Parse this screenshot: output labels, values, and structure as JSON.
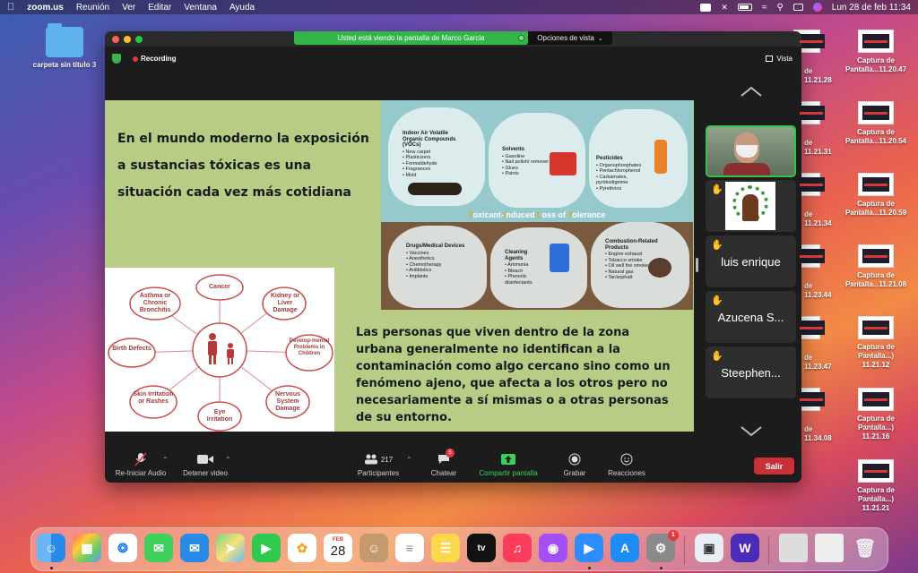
{
  "menubar": {
    "app_name": "zoom.us",
    "menus": [
      "Reunión",
      "Ver",
      "Editar",
      "Ventana",
      "Ayuda"
    ],
    "datetime": "Lun 28 de feb  11:34"
  },
  "desktop": {
    "folder_label": "carpeta sin título 3",
    "screenshots": [
      {
        "line1": "Captura de",
        "line2": "Pantalla...11.20.47"
      },
      {
        "line1": "Captura de",
        "line2": "Pantalla...11.20.54"
      },
      {
        "line1": "Captura de",
        "line2": "Pantalla...11.20.59"
      },
      {
        "line1": "Captura de",
        "line2": "Pantalla...11.21.08"
      },
      {
        "line1": "Captura de",
        "line2": "Pantalla...) 11.21.12"
      },
      {
        "line1": "Captura de",
        "line2": "Pantalla...) 11.21.16"
      },
      {
        "line1": "Captura de",
        "line2": "Pantalla...) 11.21.21"
      }
    ],
    "partial_labels": [
      {
        "line1": "de",
        "line2": "11.21.28"
      },
      {
        "line1": "de",
        "line2": "11.21.31"
      },
      {
        "line1": "de",
        "line2": "11.21.34"
      },
      {
        "line1": "de",
        "line2": "11.23.44"
      },
      {
        "line1": "de",
        "line2": "11.23.47"
      },
      {
        "line1": "de",
        "line2": "11.34.08"
      }
    ]
  },
  "zoom": {
    "share_banner": "Usted está viendo la pantalla de Marco Garcia",
    "view_options": "Opciones de vista",
    "recording": "Recording",
    "view_label": "Vista",
    "slide": {
      "top_text": "En el mundo moderno la exposición a sustancias tóxicas es una situación cada vez más cotidiana",
      "bottom_text": "Las personas que viven dentro de la zona urbana generalmente no identifican a la contaminación como algo cercano sino como un fenómeno ajeno, que afecta a los otros pero no necesariamente a sí mismas o a otras personas de su entorno.",
      "infographic": {
        "title_parts": [
          "T",
          "oxicant-",
          "I",
          "nduced ",
          "L",
          "oss of ",
          "T",
          "olerance"
        ],
        "bags": [
          {
            "title": "Indoor Air Volatile Organic Compounds (VOCs)",
            "items": [
              "• New carpet",
              "• Plasticizers",
              "• Formaldehyde",
              "• Fragrances",
              "• Mold"
            ]
          },
          {
            "title": "Solvents",
            "items": [
              "• Gasoline",
              "• Nail polish/ remover",
              "• Glues",
              "• Paints"
            ]
          },
          {
            "title": "Pesticides",
            "items": [
              "• Organophosphates",
              "• Pentachlorophenol",
              "• Carbamates, pyridostigmine",
              "• Pyrethrins"
            ]
          },
          {
            "title": "Drugs/Medical Devices",
            "items": [
              "• Vaccines",
              "• Anesthetics",
              "• Chemotherapy",
              "• Antibiotics",
              "• Implants"
            ]
          },
          {
            "title": "Cleaning Agents",
            "items": [
              "• Ammonia",
              "• Bleach",
              "• Phenolic disinfectants"
            ]
          },
          {
            "title": "Combustion-Related Products",
            "items": [
              "• Engine exhaust",
              "• Tobacco smoke",
              "• Oil well fire smoke",
              "• Natural gas",
              "• Tar/asphalt"
            ]
          }
        ]
      },
      "diagram_nodes": [
        {
          "text": "Cancer"
        },
        {
          "text": "Kidney or Liver Damage"
        },
        {
          "text": "Develop-mental Problems in Children"
        },
        {
          "text": "Nervous System Damage"
        },
        {
          "text": "Eye Irritation"
        },
        {
          "text": "Skin Irritation or Rashes"
        },
        {
          "text": "Birth Defects"
        },
        {
          "text": "Asthma or Chronic Bronchitis"
        }
      ]
    },
    "participants_panel": [
      {
        "name": "",
        "type": "video"
      },
      {
        "name": "",
        "type": "logo",
        "hand": true
      },
      {
        "name": "luis enrique",
        "hand": true
      },
      {
        "name": "Azucena S...",
        "hand": true
      },
      {
        "name": "Steephen...",
        "hand": true
      }
    ],
    "toolbar": {
      "audio": "Re-Iniciar Audio",
      "video": "Detener video",
      "participants": "Participantes",
      "participant_count": "217",
      "chat": "Chatear",
      "chat_badge": "5",
      "share": "Compartir pantalla",
      "record": "Grabar",
      "reactions": "Reacciones",
      "leave": "Salir"
    }
  },
  "dock": {
    "calendar_month": "FEB",
    "calendar_day": "28",
    "settings_badge": "1"
  },
  "colors": {
    "share_green": "#33b54a",
    "leave_red": "#c8303a",
    "slide_bg": "#b7cd86"
  }
}
